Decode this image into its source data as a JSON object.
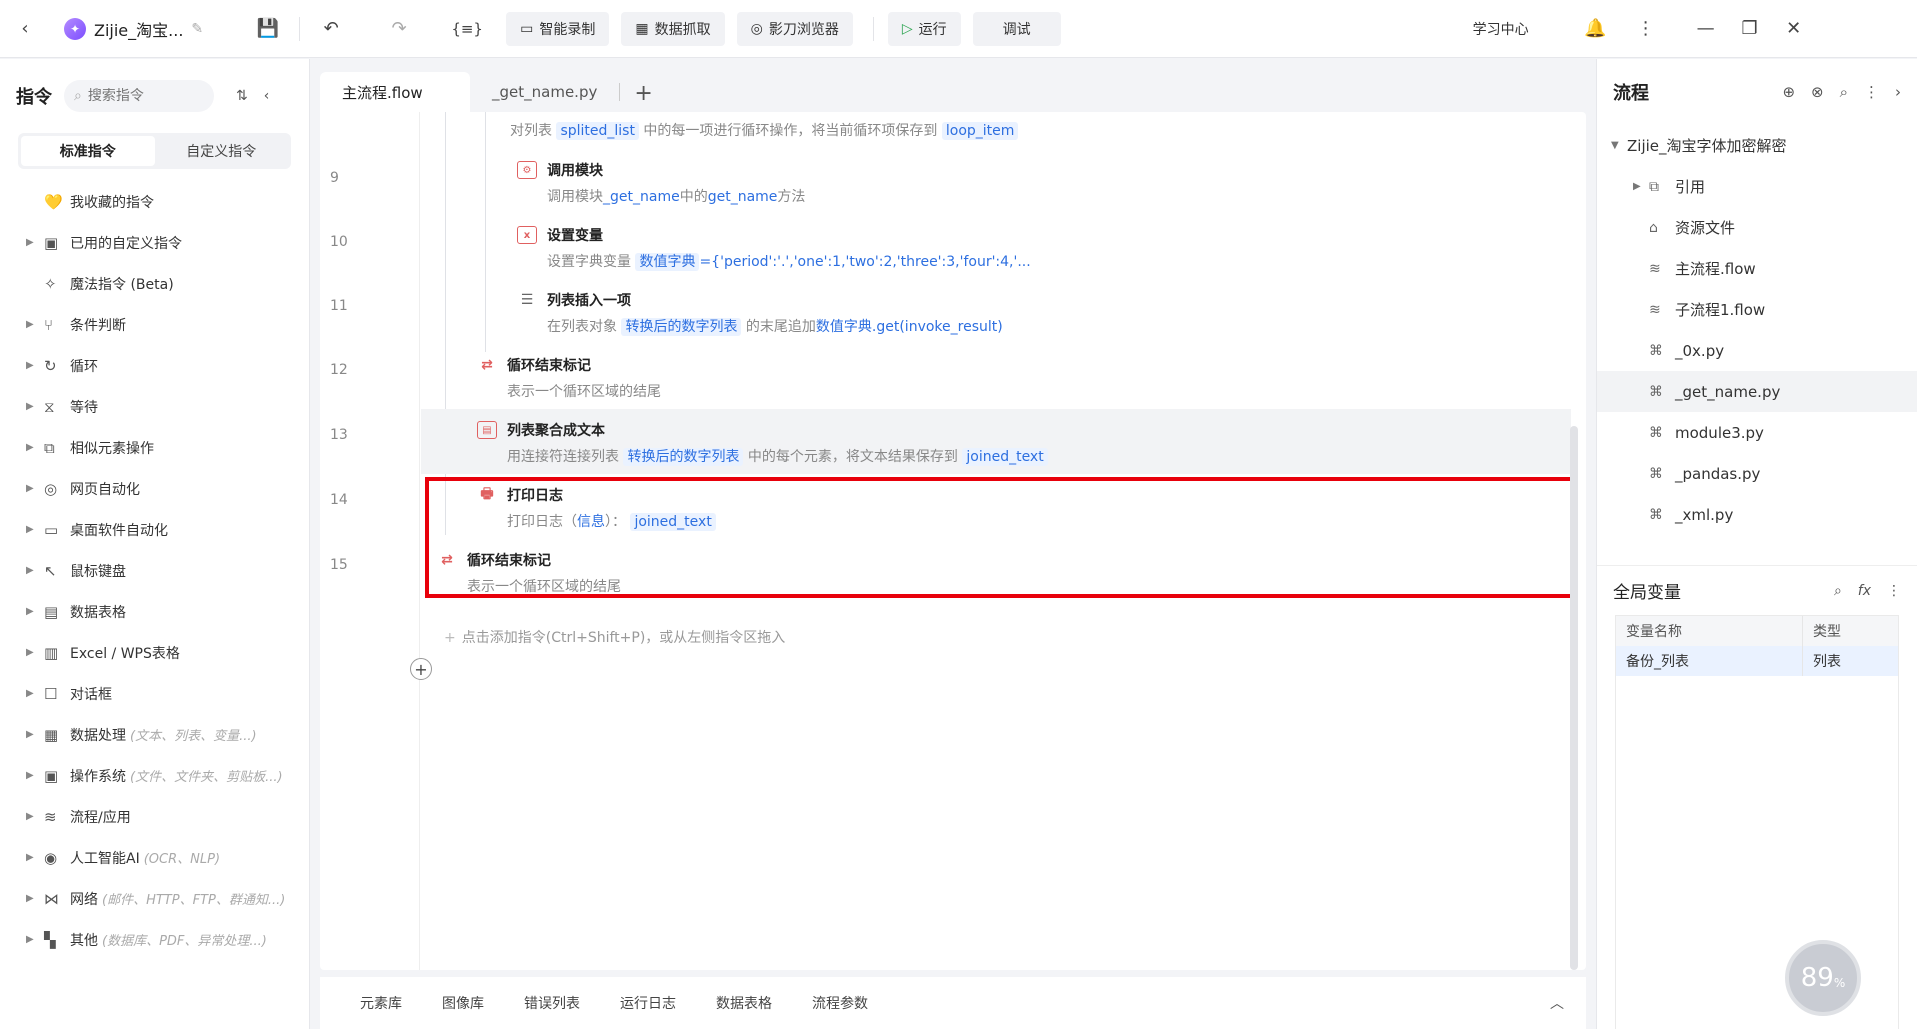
{
  "topbar": {
    "title": "Zijie_淘宝...",
    "buttons": {
      "record": "智能录制",
      "grab": "数据抓取",
      "browser": "影刀浏览器",
      "run": "运行",
      "debug": "调试"
    },
    "learn": "学习中心"
  },
  "left": {
    "title": "指令",
    "search_placeholder": "搜索指令",
    "tabs": [
      "标准指令",
      "自定义指令"
    ],
    "items": [
      {
        "label": "我收藏的指令",
        "hint": "",
        "arrow": false,
        "icon": "heart-icon"
      },
      {
        "label": "已用的自定义指令",
        "hint": "",
        "arrow": true,
        "icon": "calendar-icon"
      },
      {
        "label": "魔法指令 (Beta)",
        "hint": "",
        "arrow": false,
        "icon": "sparkle-icon"
      },
      {
        "label": "条件判断",
        "hint": "",
        "arrow": true,
        "icon": "branch-icon"
      },
      {
        "label": "循环",
        "hint": "",
        "arrow": true,
        "icon": "loop-icon"
      },
      {
        "label": "等待",
        "hint": "",
        "arrow": true,
        "icon": "hourglass-icon"
      },
      {
        "label": "相似元素操作",
        "hint": "",
        "arrow": true,
        "icon": "copy-icon"
      },
      {
        "label": "网页自动化",
        "hint": "",
        "arrow": true,
        "icon": "globe-icon"
      },
      {
        "label": "桌面软件自动化",
        "hint": "",
        "arrow": true,
        "icon": "monitor-icon"
      },
      {
        "label": "鼠标键盘",
        "hint": "",
        "arrow": true,
        "icon": "cursor-icon"
      },
      {
        "label": "数据表格",
        "hint": "",
        "arrow": true,
        "icon": "sheet-icon"
      },
      {
        "label": "Excel / WPS表格",
        "hint": "",
        "arrow": true,
        "icon": "excel-icon"
      },
      {
        "label": "对话框",
        "hint": "",
        "arrow": true,
        "icon": "dialog-icon"
      },
      {
        "label": "数据处理",
        "hint": "(文本、列表、变量...)",
        "arrow": true,
        "icon": "data-icon"
      },
      {
        "label": "操作系统",
        "hint": "(文件、文件夹、剪贴板...)",
        "arrow": true,
        "icon": "briefcase-icon"
      },
      {
        "label": "流程/应用",
        "hint": "",
        "arrow": true,
        "icon": "layers-icon"
      },
      {
        "label": "人工智能AI",
        "hint": "(OCR、NLP)",
        "arrow": true,
        "icon": "ai-icon"
      },
      {
        "label": "网络",
        "hint": "(邮件、HTTP、FTP、群通知...)",
        "arrow": true,
        "icon": "share-icon"
      },
      {
        "label": "其他",
        "hint": "(数据库、PDF、异常处理...)",
        "arrow": true,
        "icon": "grid-icon"
      }
    ]
  },
  "editor": {
    "tabs": [
      "主流程.flow",
      "_get_name.py"
    ],
    "line_numbers": [
      "9",
      "10",
      "11",
      "12",
      "13",
      "14",
      "15"
    ],
    "step0": {
      "desc_pre": "对列表",
      "var1": "splited_list",
      "desc_mid": "中的每一项进行循环操作，将当前循环项保存到",
      "var2": "loop_item"
    },
    "step9": {
      "title": "调用模块",
      "desc_pre": "调用模块",
      "m1": "_get_name",
      "desc_mid": "中的",
      "m2": "get_name",
      "desc_post": "方法"
    },
    "step10": {
      "title": "设置变量",
      "desc_pre": "设置字典变量",
      "var": "数值字典",
      "val": "={'period':'.','one':1,'two':2,'three':3,'four':4,'..."
    },
    "step11": {
      "title": "列表插入一项",
      "desc_pre": "在列表对象",
      "var": "转换后的数字列表",
      "desc_mid": "的末尾追加",
      "expr": "数值字典.get(invoke_result)"
    },
    "step12": {
      "title": "循环结束标记",
      "desc": "表示一个循环区域的结尾"
    },
    "step13": {
      "title": "列表聚合成文本",
      "desc_pre": "用连接符连接列表",
      "var": "转换后的数字列表",
      "desc_mid": "中的每个元素，将文本结果保存到",
      "var2": "joined_text"
    },
    "step14": {
      "title": "打印日志",
      "desc_pre": "打印日志（",
      "level": "信息",
      "desc_mid": "）：",
      "var": "joined_text"
    },
    "step15": {
      "title": "循环结束标记",
      "desc": "表示一个循环区域的结尾"
    },
    "add_hint": "点击添加指令(Ctrl+Shift+P)，或从左侧指令区拖入"
  },
  "bottom_tabs": [
    "元素库",
    "图像库",
    "错误列表",
    "运行日志",
    "数据表格",
    "流程参数"
  ],
  "right": {
    "title": "流程",
    "tree": [
      {
        "label": "Zijie_淘宝字体加密解密",
        "indent": 0,
        "arrow": "▼",
        "icon": ""
      },
      {
        "label": "引用",
        "indent": 1,
        "arrow": "▶",
        "icon": "ref-icon"
      },
      {
        "label": "资源文件",
        "indent": 1,
        "arrow": "",
        "icon": "folder-icon"
      },
      {
        "label": "主流程.flow",
        "indent": 1,
        "arrow": "",
        "icon": "layers-icon"
      },
      {
        "label": "子流程1.flow",
        "indent": 1,
        "arrow": "",
        "icon": "layers-icon"
      },
      {
        "label": "_0x.py",
        "indent": 1,
        "arrow": "",
        "icon": "python-icon"
      },
      {
        "label": "_get_name.py",
        "indent": 1,
        "arrow": "",
        "icon": "python-icon",
        "selected": true
      },
      {
        "label": "module3.py",
        "indent": 1,
        "arrow": "",
        "icon": "python-icon"
      },
      {
        "label": "_pandas.py",
        "indent": 1,
        "arrow": "",
        "icon": "python-icon"
      },
      {
        "label": "_xml.py",
        "indent": 1,
        "arrow": "",
        "icon": "python-icon"
      }
    ],
    "global_vars": {
      "title": "全局变量",
      "headers": [
        "变量名称",
        "类型"
      ],
      "rows": [
        [
          "备份_列表",
          "列表"
        ]
      ]
    }
  },
  "badge": {
    "value": "89",
    "unit": "%"
  }
}
